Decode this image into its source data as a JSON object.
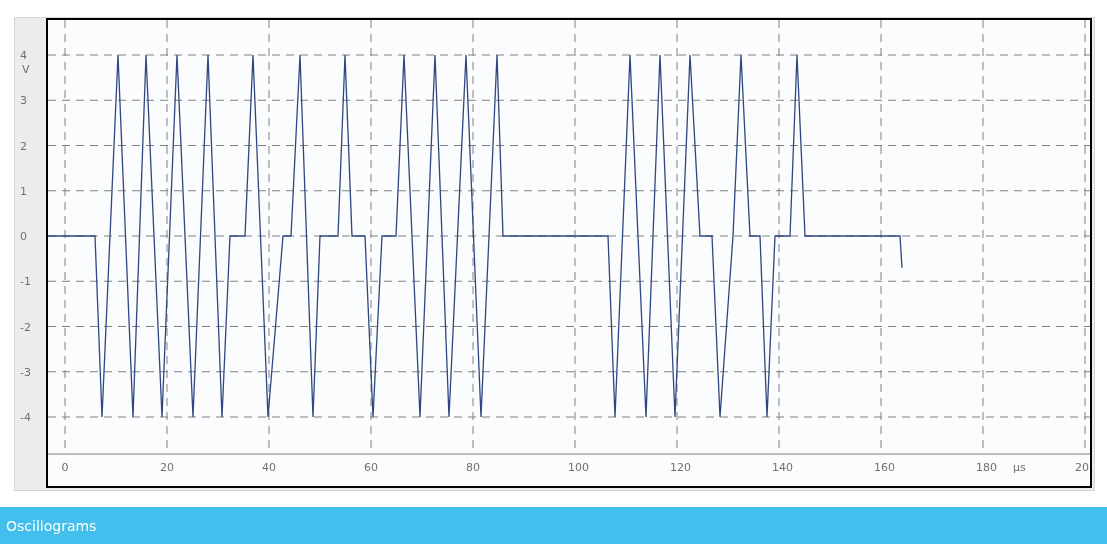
{
  "chart": {
    "y_axis": {
      "unit": "V",
      "ticks": [
        "4",
        "3",
        "2",
        "1",
        "0",
        "-1",
        "-2",
        "-3",
        "-4"
      ]
    },
    "x_axis": {
      "unit": "µs",
      "ticks": [
        "0",
        "20",
        "40",
        "60",
        "80",
        "100",
        "120",
        "140",
        "160",
        "180",
        "20"
      ]
    }
  },
  "footer": {
    "title": "Oscillograms"
  }
}
